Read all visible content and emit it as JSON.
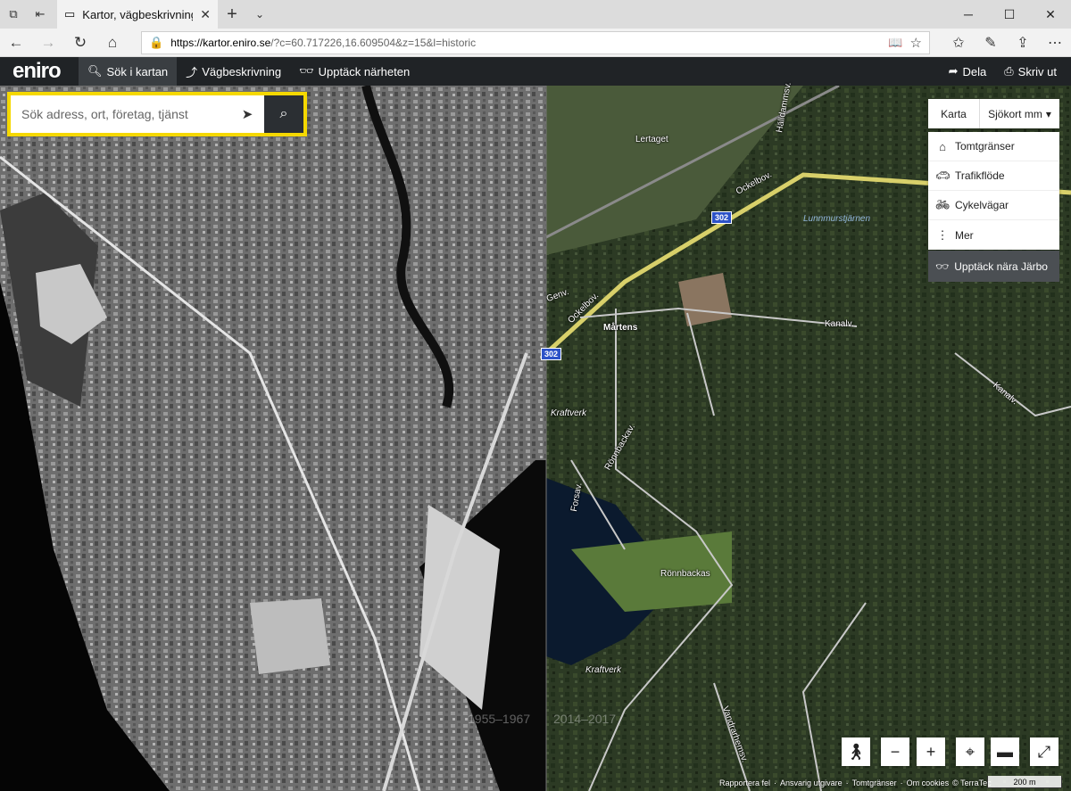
{
  "browser": {
    "tab_title": "Kartor, vägbeskrivninga",
    "url_host": "https://kartor.eniro.se",
    "url_rest": "/?c=60.717226,16.609504&z=15&l=historic"
  },
  "eniro": {
    "logo": "eniro",
    "nav": [
      {
        "label": "Sök i kartan"
      },
      {
        "label": "Vägbeskrivning"
      },
      {
        "label": "Upptäck närheten"
      }
    ],
    "share_label": "Dela",
    "print_label": "Skriv ut"
  },
  "search": {
    "placeholder": "Sök adress, ort, företag, tjänst"
  },
  "map_type": {
    "karta": "Karta",
    "selected": "Sjökort mm"
  },
  "layers": [
    {
      "label": "Tomtgränser",
      "icon": "house-icon"
    },
    {
      "label": "Trafikflöde",
      "icon": "car-icon"
    },
    {
      "label": "Cykelvägar",
      "icon": "bicycle-icon"
    },
    {
      "label": "Mer",
      "icon": "more-icon"
    }
  ],
  "explore_label": "Upptäck nära Järbo",
  "years": {
    "left": "1955–1967",
    "right": "2014–2017"
  },
  "map_labels": {
    "lertaget": "Lertaget",
    "ockelbov1": "Ockelbov.",
    "ockelbov2": "Ockelbov.",
    "road_302a": "302",
    "road_302b": "302",
    "lunnmurst": "Lunnmurstjärnen",
    "genv": "Genv.",
    "martens": "Mårtens",
    "kanalv1": "Kanalv.",
    "kanalv2": "Kanalv.",
    "kraftverk1": "Kraftverk",
    "kraftverk2": "Kraftverk",
    "ronnbackav": "Rönnbackav.",
    "forsav": "Forsav.",
    "ronnbackas": "Rönnbackas",
    "vandrarhemsv": "Vandrarhemsv.",
    "hallamnsv": "Hälldammsv."
  },
  "attribution": [
    "Rapportera fel",
    "Ansvarig utgivare",
    "Tomtgränser",
    "Om cookies",
    "© TerraTec"
  ],
  "scale": "200 m"
}
